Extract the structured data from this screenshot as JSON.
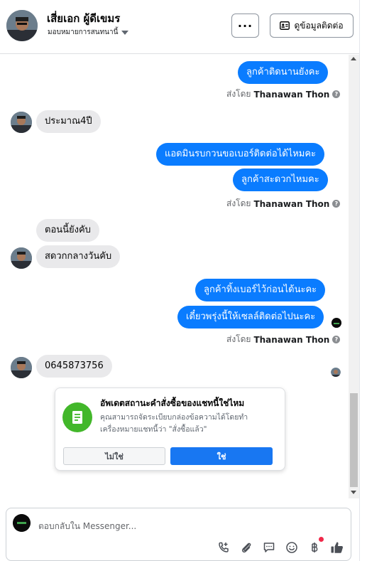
{
  "header": {
    "contact_name": "เสี่ยเอก ผู้ดีเขมร",
    "assign_label": "มอบหมายการสนทนานี้",
    "more_label": "···",
    "contact_info_label": "ดูข้อมูลติดต่อ"
  },
  "messages": [
    {
      "direction": "out",
      "text": "ลูกค้าติดนานยังคะ"
    },
    {
      "direction": "meta",
      "sent_prefix": "ส่งโดย",
      "sender": "Thanawan Thon"
    },
    {
      "direction": "in",
      "text": "ประมาณ4ปี"
    },
    {
      "direction": "out",
      "text": "แอดมินรบกวนขอเบอร์ติดต่อได้ไหมคะ"
    },
    {
      "direction": "out",
      "text": "ลูกค้าสะดวกไหมคะ"
    },
    {
      "direction": "meta",
      "sent_prefix": "ส่งโดย",
      "sender": "Thanawan Thon"
    },
    {
      "direction": "in",
      "text": "ตอนนี้ยังคับ"
    },
    {
      "direction": "in",
      "text": "สดวกกลางวันคับ"
    },
    {
      "direction": "out",
      "text": "ลูกค้าทิ้งเบอร์ไว้ก่อนได้นะคะ"
    },
    {
      "direction": "out",
      "text": "เดี๋ยวพรุ่งนี้ให้เซลล์ติดต่อไปนะคะ"
    },
    {
      "direction": "meta",
      "sent_prefix": "ส่งโดย",
      "sender": "Thanawan Thon"
    },
    {
      "direction": "in",
      "text": "0645873756"
    }
  ],
  "order_card": {
    "title": "อัพเดตสถานะคำสั่งซื้อของแชทนี้ใช่ไหม",
    "body": "คุณสามารถจัดระเบียบกล่องข้อความได้โดยทำเครื่องหมายแชทนี้ว่า \"สั่งซื้อแล้ว\"",
    "no_label": "ไม่ใช่",
    "yes_label": "ใช่"
  },
  "composer": {
    "placeholder": "ตอบกลับใน Messenger...",
    "tools": [
      "phone-plus-icon",
      "attachment-icon",
      "saved-reply-icon",
      "emoji-icon",
      "baht-payment-icon",
      "like-icon"
    ]
  },
  "colors": {
    "outgoing": "#0a7cff",
    "incoming": "#e9e9eb",
    "primary_button": "#1877f2",
    "order_icon": "#42b72a",
    "notification": "#f02849"
  }
}
